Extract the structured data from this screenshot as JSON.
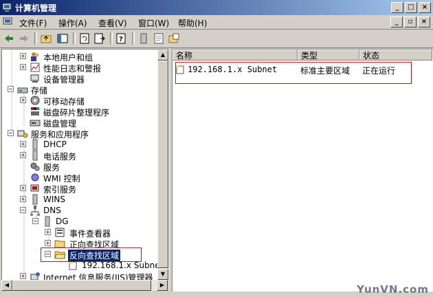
{
  "window": {
    "title": "计算机管理"
  },
  "menu": [
    {
      "label": "文件(F)"
    },
    {
      "label": "操作(A)"
    },
    {
      "label": "查看(V)"
    },
    {
      "label": "窗口(W)"
    },
    {
      "label": "帮助(H)"
    }
  ],
  "tree": [
    {
      "label": "本地用户和组",
      "icon": "users-icon"
    },
    {
      "label": "性能日志和警报",
      "icon": "performance-icon"
    },
    {
      "label": "设备管理器",
      "icon": "device-manager-icon"
    },
    {
      "label": "存储",
      "icon": "storage-icon"
    },
    {
      "label": "可移动存储",
      "icon": "removable-storage-icon"
    },
    {
      "label": "磁盘碎片整理程序",
      "icon": "defrag-icon"
    },
    {
      "label": "磁盘管理",
      "icon": "disk-management-icon"
    },
    {
      "label": "服务和应用程序",
      "icon": "services-apps-icon"
    },
    {
      "label": "DHCP",
      "icon": "server-icon"
    },
    {
      "label": "电话服务",
      "icon": "telephony-icon"
    },
    {
      "label": "服务",
      "icon": "gears-icon"
    },
    {
      "label": "WMI 控制",
      "icon": "wmi-icon"
    },
    {
      "label": "索引服务",
      "icon": "indexing-icon"
    },
    {
      "label": "WINS",
      "icon": "server-icon"
    },
    {
      "label": "DNS",
      "icon": "dns-icon"
    },
    {
      "label": "DG",
      "icon": "server-icon"
    },
    {
      "label": "事件查看器",
      "icon": "event-viewer-icon"
    },
    {
      "label": "正向查找区域",
      "icon": "folder-icon"
    },
    {
      "label": "反向查找区域",
      "icon": "folder-open-icon"
    },
    {
      "label": "192.168.1.x Subnet",
      "icon": "zone-icon"
    },
    {
      "label": "Internet 信息服务(IIS)管理器",
      "icon": "iis-icon"
    }
  ],
  "list": {
    "columns": [
      "名称",
      "类型",
      "状态"
    ],
    "rows": [
      {
        "name": "192.168.1.x Subnet",
        "type": "标准主要区域",
        "status": "正在运行"
      }
    ]
  },
  "watermark": "YunVN.com",
  "colors": {
    "titlebar": "#0a246a",
    "highlight": "#e00000"
  }
}
